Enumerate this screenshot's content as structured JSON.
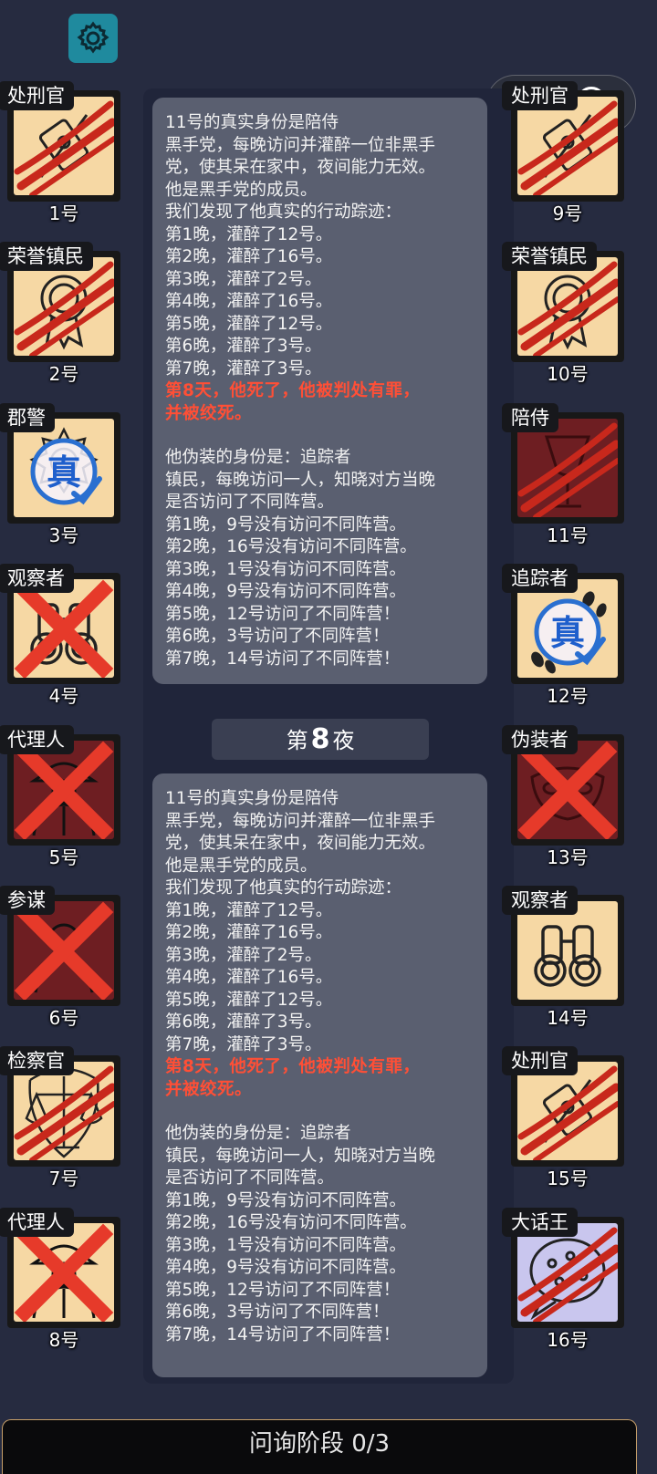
{
  "settings": {
    "icon": "gear-icon"
  },
  "capsule": {
    "icons": [
      "more-icon",
      "close-circle-icon"
    ]
  },
  "players": [
    {
      "num": "1号",
      "role": "处刑官",
      "icon": "pillory-icon",
      "bg": "light",
      "mark": "claw"
    },
    {
      "num": "2号",
      "role": "荣誉镇民",
      "icon": "medal-icon",
      "bg": "light",
      "mark": "claw"
    },
    {
      "num": "3号",
      "role": "郡警",
      "icon": "badge-icon",
      "bg": "light",
      "mark": "true-stamp",
      "stamp_text": "真"
    },
    {
      "num": "4号",
      "role": "观察者",
      "icon": "binoculars-icon",
      "bg": "light",
      "mark": "x"
    },
    {
      "num": "5号",
      "role": "代理人",
      "icon": "agent-icon",
      "bg": "dark",
      "mark": "x"
    },
    {
      "num": "6号",
      "role": "参谋",
      "icon": "staff-icon",
      "bg": "dark",
      "mark": "x"
    },
    {
      "num": "7号",
      "role": "检察官",
      "icon": "scales-icon",
      "bg": "light",
      "mark": "claw"
    },
    {
      "num": "8号",
      "role": "代理人",
      "icon": "agent-icon",
      "bg": "light",
      "mark": "x"
    },
    {
      "num": "9号",
      "role": "处刑官",
      "icon": "pillory-icon",
      "bg": "light",
      "mark": "claw"
    },
    {
      "num": "10号",
      "role": "荣誉镇民",
      "icon": "medal-icon",
      "bg": "light",
      "mark": "claw"
    },
    {
      "num": "11号",
      "role": "陪侍",
      "icon": "glass-icon",
      "bg": "dark",
      "mark": "claw"
    },
    {
      "num": "12号",
      "role": "追踪者",
      "icon": "footprints-icon",
      "bg": "light",
      "mark": "true-stamp",
      "stamp_text": "真"
    },
    {
      "num": "13号",
      "role": "伪装者",
      "icon": "mask-icon",
      "bg": "dark",
      "mark": "x"
    },
    {
      "num": "14号",
      "role": "观察者",
      "icon": "binoculars-icon",
      "bg": "light",
      "mark": "none"
    },
    {
      "num": "15号",
      "role": "处刑官",
      "icon": "pillory-icon",
      "bg": "light",
      "mark": "claw"
    },
    {
      "num": "16号",
      "role": "大话王",
      "icon": "speech-bubble-icon",
      "bg": "lilac",
      "mark": "claw"
    }
  ],
  "log_entries": [
    {
      "lines_a": [
        "11号的真实身份是陪侍",
        "黑手党，每晚访问并灌醉一位非黑手",
        "党，使其呆在家中，夜间能力无效。",
        "他是黑手党的成员。",
        "我们发现了他真实的行动踪迹：",
        "第1晚，灌醉了12号。",
        "第2晚，灌醉了16号。",
        "第3晚，灌醉了2号。",
        "第4晚，灌醉了16号。",
        "第5晚，灌醉了12号。",
        "第6晚，灌醉了3号。",
        "第7晚，灌醉了3号。"
      ],
      "death": [
        "第8天，他死了，他被判处有罪，",
        "并被绞死。"
      ],
      "lines_b": [
        "他伪装的身份是：追踪者",
        "镇民，每晚访问一人，知晓对方当晚",
        "是否访问了不同阵营。",
        "第1晚，9号没有访问不同阵营。",
        "第2晚，16号没有访问不同阵营。",
        "第3晚，1号没有访问不同阵营。",
        "第4晚，9号没有访问不同阵营。",
        "第5晚，12号访问了不同阵营！",
        "第6晚，3号访问了不同阵营！",
        "第7晚，14号访问了不同阵营！"
      ]
    },
    {
      "lines_a": [
        "11号的真实身份是陪侍",
        "黑手党，每晚访问并灌醉一位非黑手",
        "党，使其呆在家中，夜间能力无效。",
        "他是黑手党的成员。",
        "我们发现了他真实的行动踪迹：",
        "第1晚，灌醉了12号。",
        "第2晚，灌醉了16号。",
        "第3晚，灌醉了2号。",
        "第4晚，灌醉了16号。",
        "第5晚，灌醉了12号。",
        "第6晚，灌醉了3号。",
        "第7晚，灌醉了3号。"
      ],
      "death": [
        "第8天，他死了，他被判处有罪，",
        "并被绞死。"
      ],
      "lines_b": [
        "他伪装的身份是：追踪者",
        "镇民，每晚访问一人，知晓对方当晚",
        "是否访问了不同阵营。",
        "第1晚，9号没有访问不同阵营。",
        "第2晚，16号没有访问不同阵营。",
        "第3晚，1号没有访问不同阵营。",
        "第4晚，9号没有访问不同阵营。",
        "第5晚，12号访问了不同阵营！",
        "第6晚，3号访问了不同阵营！",
        "第7晚，14号访问了不同阵营！"
      ]
    }
  ],
  "night_label": {
    "prefix": "第",
    "number": "8",
    "suffix": "夜"
  },
  "phase_bar": {
    "label": "问询阶段 0/3"
  }
}
